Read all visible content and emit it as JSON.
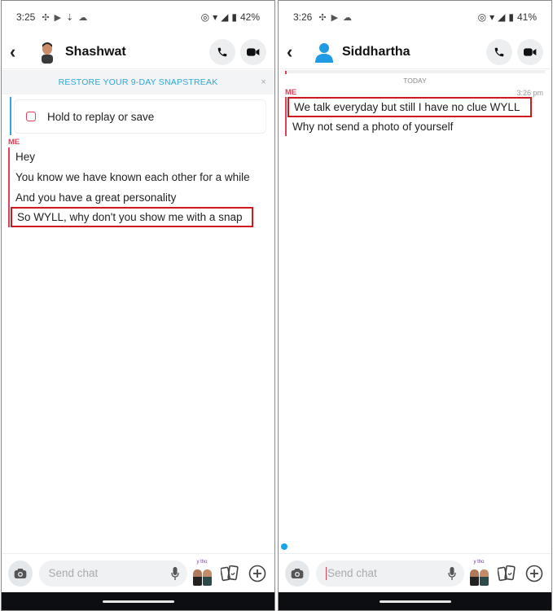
{
  "left": {
    "status": {
      "time": "3:25",
      "battery": "42%"
    },
    "header": {
      "name": "Shashwat"
    },
    "streak_banner": {
      "text": "RESTORE YOUR 9-DAY SNAPSTREAK",
      "close": "×"
    },
    "snap_card": {
      "label": "Hold to replay or save"
    },
    "me_label": "ME",
    "messages": [
      {
        "text": "Hey"
      },
      {
        "text": "You know we have known each other for a while"
      },
      {
        "text": "And you have a great personality"
      },
      {
        "text": "So WYLL, why don't you show me with a snap",
        "highlighted": true
      }
    ],
    "input": {
      "placeholder": "Send chat"
    },
    "bitmoji_label": "y tho"
  },
  "right": {
    "status": {
      "time": "3:26",
      "battery": "41%"
    },
    "header": {
      "name": "Siddhartha"
    },
    "day_separator": "TODAY",
    "me_label": "ME",
    "timestamp": "3:26 pm",
    "messages": [
      {
        "text": "We talk everyday but still I have no clue WYLL",
        "highlighted": true
      },
      {
        "text": "Why not send a photo of yourself"
      }
    ],
    "input": {
      "placeholder": "Send chat"
    },
    "bitmoji_label": "y tho"
  },
  "colors": {
    "accent_red": "#e0405a",
    "highlight_red": "#d0181f",
    "streak_blue": "#2fa7d8",
    "typing_dot": "#1aa3e8"
  }
}
